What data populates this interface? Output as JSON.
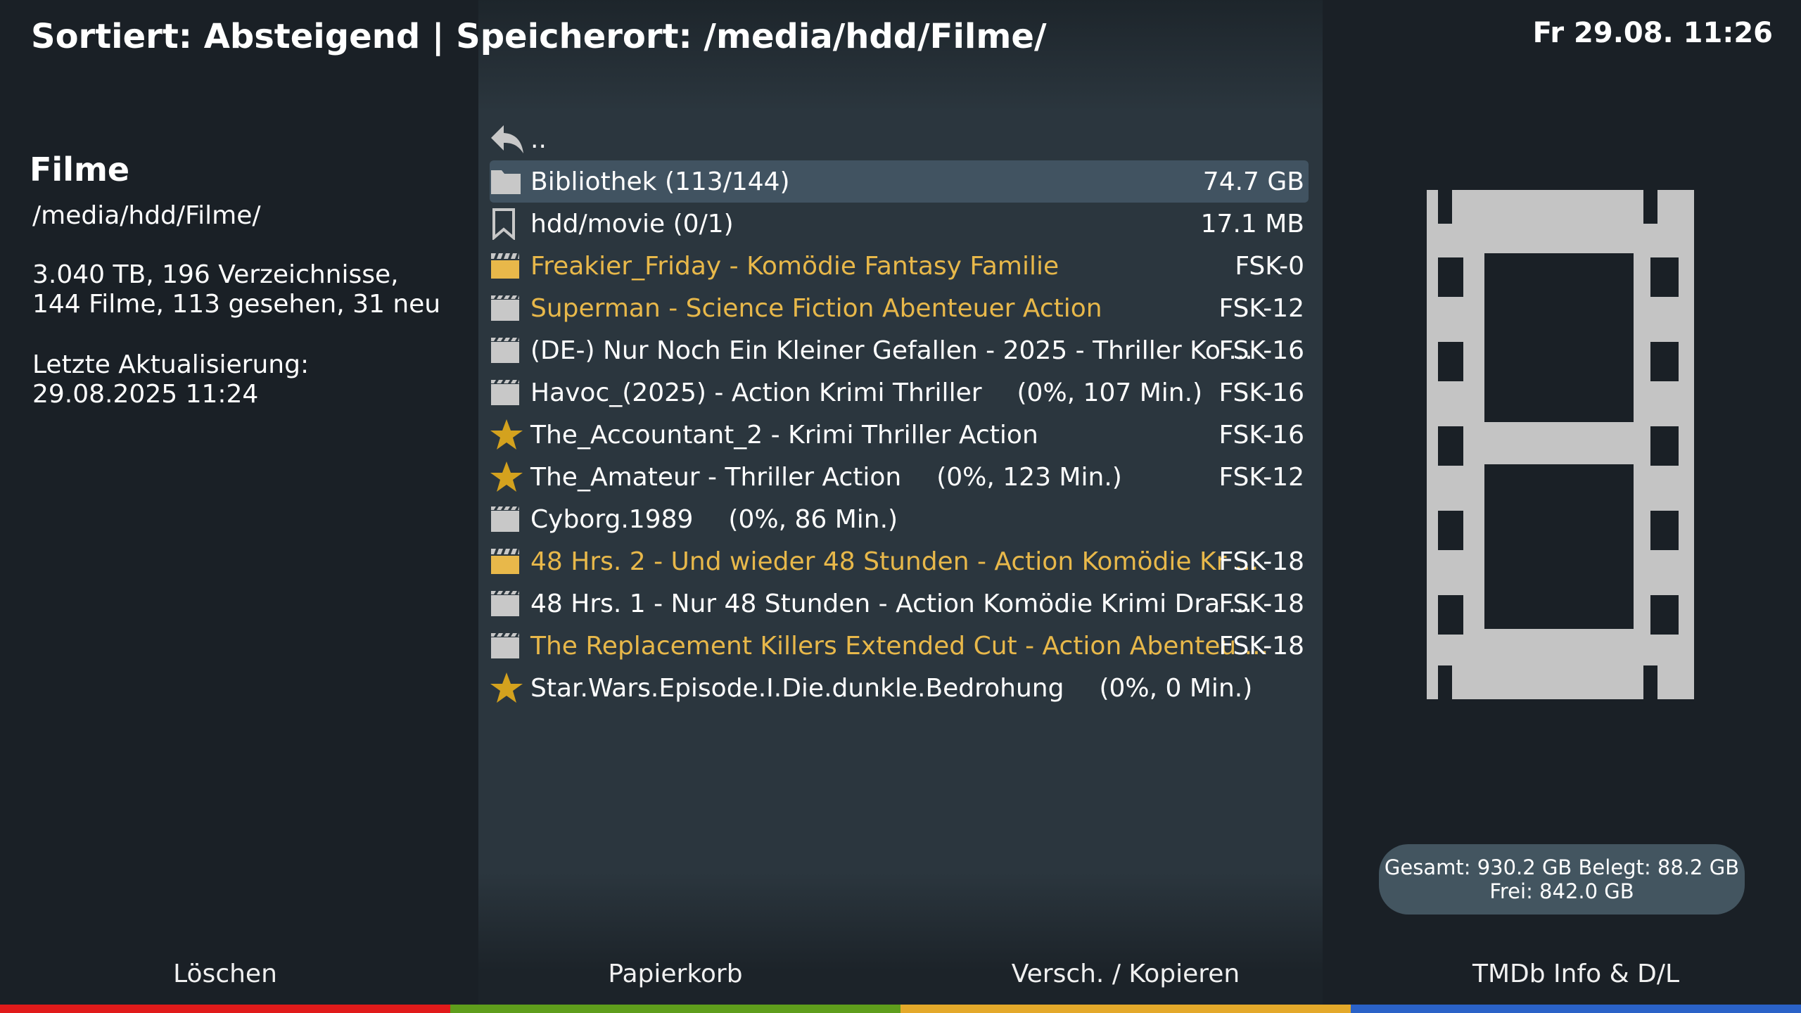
{
  "header": {
    "title": "Sortiert: Absteigend | Speicherort: /media/hdd/Filme/",
    "clock": "Fr 29.08.  11:26"
  },
  "info": {
    "title": "Filme",
    "path": "/media/hdd/Filme/",
    "stats": "3.040 TB, 196 Verzeichnisse, 144 Filme, 113 gesehen, 31 neu",
    "update": "Letzte Aktualisierung: 29.08.2025 11:24"
  },
  "colors": {
    "highlight_text": "#e8b84a",
    "selection": "#415361",
    "icon_gray": "#c8c8c8",
    "star": "#d4a21e"
  },
  "list": {
    "items": [
      {
        "icon": "back-arrow-icon",
        "name": "..",
        "extra": "",
        "right": ""
      },
      {
        "icon": "folder-icon",
        "name": "Bibliothek (113/144)",
        "extra": "",
        "right": "74.7 GB",
        "selected": true
      },
      {
        "icon": "bookmark-icon",
        "name": "hdd/movie (0/1)",
        "extra": "",
        "right": "17.1 MB"
      },
      {
        "icon": "clapperboard-new-icon",
        "name": "Freakier_Friday - Komödie Fantasy Familie",
        "extra": "",
        "right": "FSK-0",
        "highlight": true
      },
      {
        "icon": "clapperboard-icon",
        "name": "Superman - Science Fiction Abenteuer Action",
        "extra": "",
        "right": "FSK-12",
        "highlight": true
      },
      {
        "icon": "clapperboard-icon",
        "name": "(DE-) Nur Noch Ein Kleiner Gefallen - 2025 - Thriller Ko ...",
        "extra": "",
        "right": "FSK-16"
      },
      {
        "icon": "clapperboard-icon",
        "name": "Havoc_(2025) - Action Krimi Thriller",
        "extra": "(0%, 107 Min.)",
        "right": "FSK-16"
      },
      {
        "icon": "star-icon",
        "name": "The_Accountant_2 - Krimi Thriller Action",
        "extra": "",
        "right": "FSK-16"
      },
      {
        "icon": "star-icon",
        "name": "The_Amateur - Thriller Action",
        "extra": "(0%, 123 Min.)",
        "right": "FSK-12"
      },
      {
        "icon": "clapperboard-icon",
        "name": "Cyborg.1989",
        "extra": "(0%, 86 Min.)",
        "right": ""
      },
      {
        "icon": "clapperboard-new-icon",
        "name": "48 Hrs. 2 - Und wieder 48 Stunden - Action Komödie Kr ...",
        "extra": "",
        "right": "FSK-18",
        "highlight": true
      },
      {
        "icon": "clapperboard-icon",
        "name": "48 Hrs. 1 - Nur 48 Stunden - Action Komödie Krimi Dra ...",
        "extra": "",
        "right": "FSK-18"
      },
      {
        "icon": "clapperboard-icon",
        "name": "The Replacement Killers Extended Cut - Action Abenteu ...",
        "extra": "",
        "right": "FSK-18",
        "highlight": true
      },
      {
        "icon": "star-icon",
        "name": "Star.Wars.Episode.I.Die.dunkle.Bedrohung",
        "extra": "(0%, 0 Min.)",
        "right": ""
      }
    ]
  },
  "disk": {
    "line1": "Gesamt: 930.2 GB Belegt: 88.2 GB",
    "line2": "Frei: 842.0 GB"
  },
  "buttons": {
    "red": "Löschen",
    "green": "Papierkorb",
    "yellow": "Versch. / Kopieren",
    "blue": "TMDb Info & D/L"
  }
}
